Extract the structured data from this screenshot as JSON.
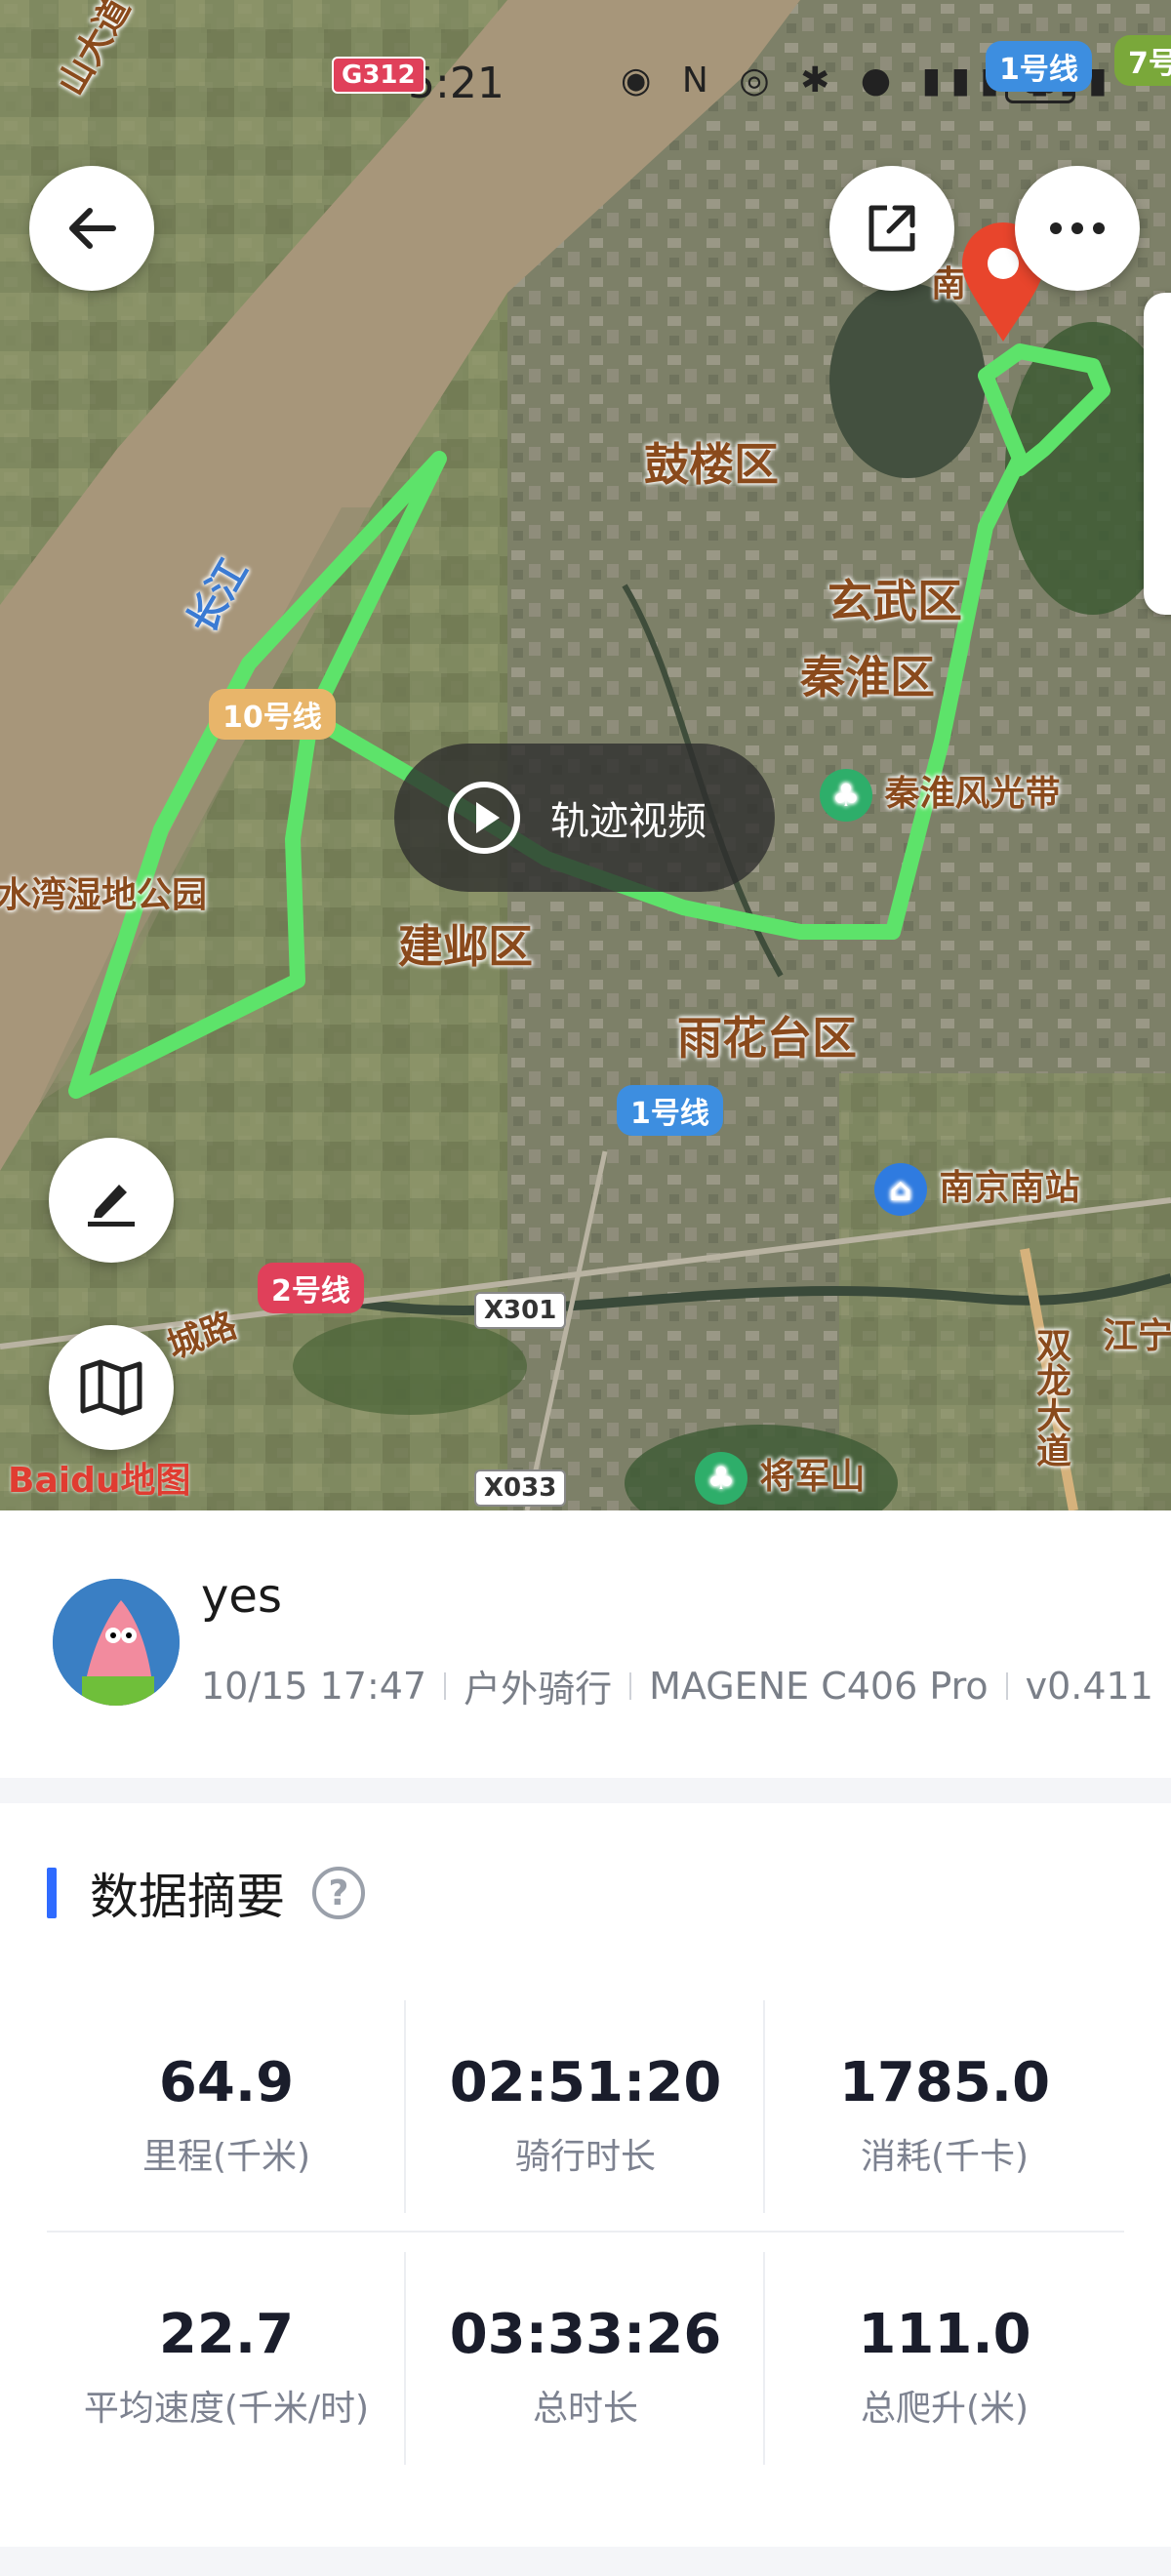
{
  "status_bar": {
    "time": "5:21",
    "battery": "80"
  },
  "map": {
    "districts": [
      "鼓楼区",
      "玄武区",
      "秦淮区",
      "建邺区",
      "雨花台区"
    ],
    "water_label": "长江",
    "pois": {
      "scenic": "秦淮风光带",
      "station": "南京南站",
      "mountain": "将军山",
      "park": "水湾湿地公园",
      "road_name": "城路",
      "expressway": "双龙大道",
      "jiangning": "江宁",
      "top_left_road": "山大道",
      "top_center_fragment": "南"
    },
    "metro": {
      "line1_top": "1号线",
      "line1_mid": "1号线",
      "line2": "2号线",
      "line10": "10号线",
      "line7": "7号"
    },
    "roads": {
      "g312": "G312",
      "x301": "X301",
      "x033": "X033"
    },
    "video_button_label": "轨迹视频",
    "map_logo": "Baidu地图"
  },
  "user": {
    "name": "yes",
    "datetime": "10/15 17:47",
    "activity": "户外骑行",
    "device": "MAGENE C406 Pro",
    "version": "v0.411"
  },
  "summary": {
    "title": "数据摘要",
    "help_icon": "?",
    "stats": [
      {
        "value": "64.9",
        "label": "里程(千米)"
      },
      {
        "value": "02:51:20",
        "label": "骑行时长"
      },
      {
        "value": "1785.0",
        "label": "消耗(千卡)"
      },
      {
        "value": "22.7",
        "label": "平均速度(千米/时)"
      },
      {
        "value": "03:33:26",
        "label": "总时长"
      },
      {
        "value": "111.0",
        "label": "总爬升(米)"
      }
    ]
  },
  "colors": {
    "route": "#5de36a",
    "accent": "#2f6bff",
    "map_pin": "#e8452c"
  }
}
